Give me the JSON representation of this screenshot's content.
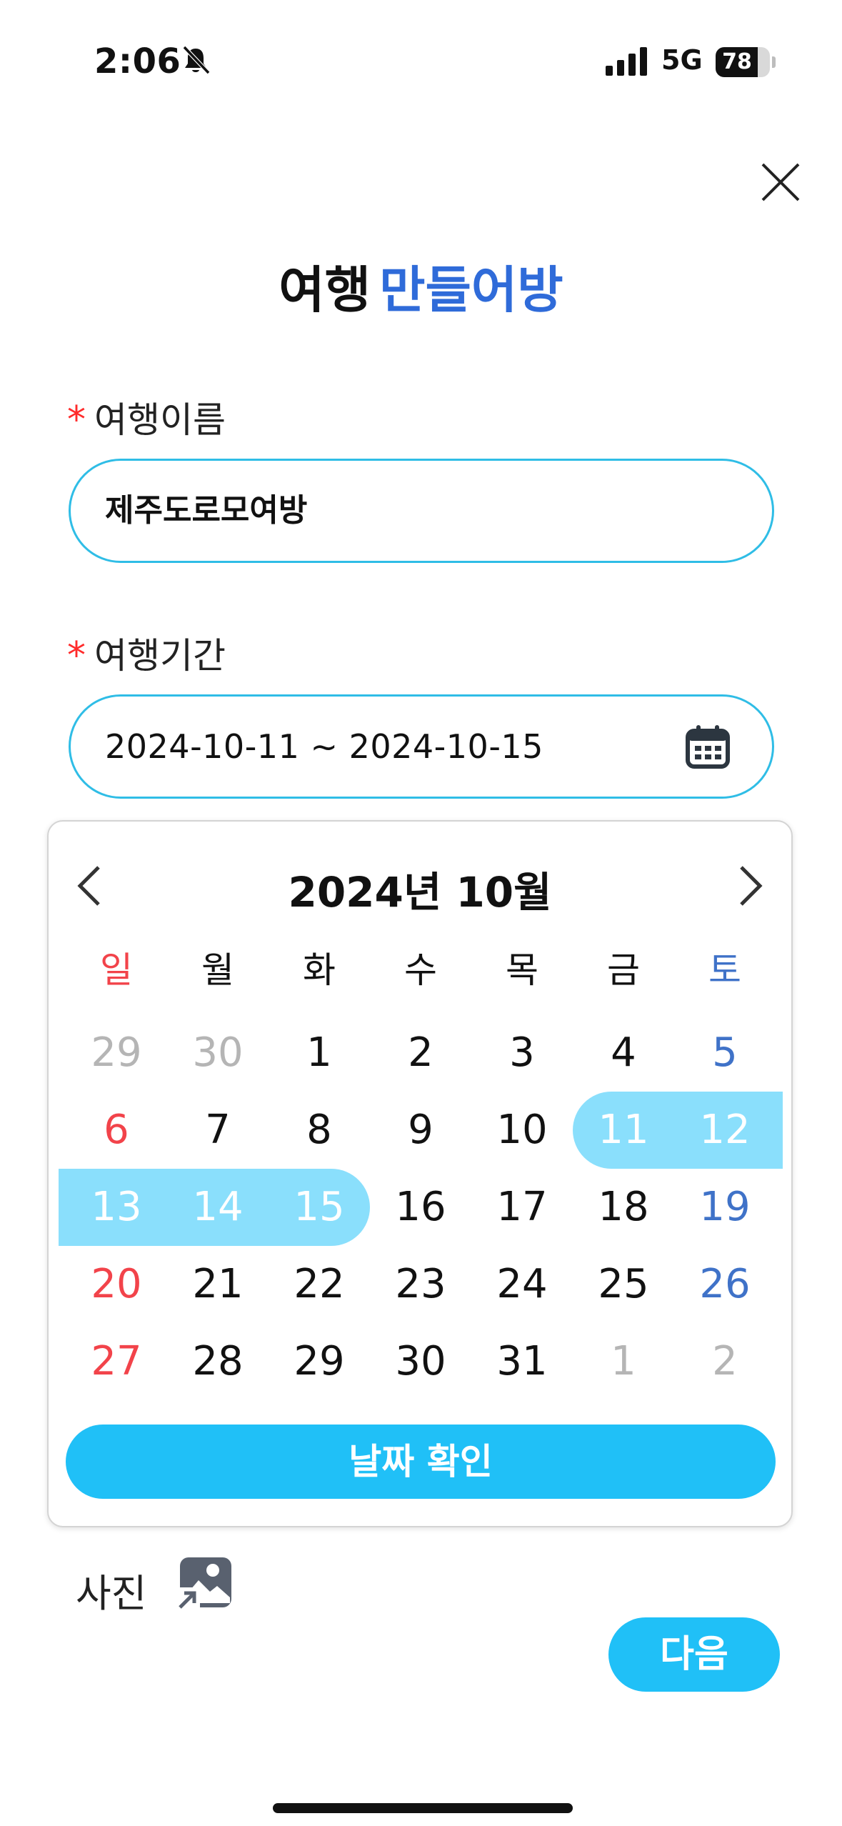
{
  "status_bar": {
    "time": "2:06",
    "network": "5G",
    "battery": "78",
    "battery_level": 0.78
  },
  "header": {
    "title_part1": "여행",
    "title_part2": "만들어방",
    "title_part2_color": "#2f6bd9"
  },
  "form": {
    "name_label": "여행이름",
    "name_value": "제주도로모여방",
    "period_label": "여행기간",
    "period_value": "2024-10-11 ~ 2024-10-15",
    "required_mark": "*",
    "accent_border_color": "#2fbde6"
  },
  "calendar": {
    "month_label": "2024년 10월",
    "weekdays": [
      "일",
      "월",
      "화",
      "수",
      "목",
      "금",
      "토"
    ],
    "weeks": [
      [
        "29",
        "30",
        "1",
        "2",
        "3",
        "4",
        "5"
      ],
      [
        "6",
        "7",
        "8",
        "9",
        "10",
        "11",
        "12"
      ],
      [
        "13",
        "14",
        "15",
        "16",
        "17",
        "18",
        "19"
      ],
      [
        "20",
        "21",
        "22",
        "23",
        "24",
        "25",
        "26"
      ],
      [
        "27",
        "28",
        "29",
        "30",
        "31",
        "1",
        "2"
      ]
    ],
    "other_month": [
      [
        0,
        0
      ],
      [
        0,
        1
      ],
      [
        4,
        5
      ],
      [
        4,
        6
      ]
    ],
    "range_start": "11",
    "range_end": "15",
    "selected": [
      [
        1,
        5
      ],
      [
        1,
        6
      ],
      [
        2,
        0
      ],
      [
        2,
        1
      ],
      [
        2,
        2
      ]
    ],
    "confirm_label": "날짜 확인",
    "colors": {
      "sunday": "#f2434a",
      "saturday": "#3f72c8",
      "range": "#8adffc",
      "button": "#20c0f7"
    }
  },
  "photo": {
    "label": "사진",
    "icon": "image-add-icon"
  },
  "footer": {
    "next_label": "다음"
  }
}
